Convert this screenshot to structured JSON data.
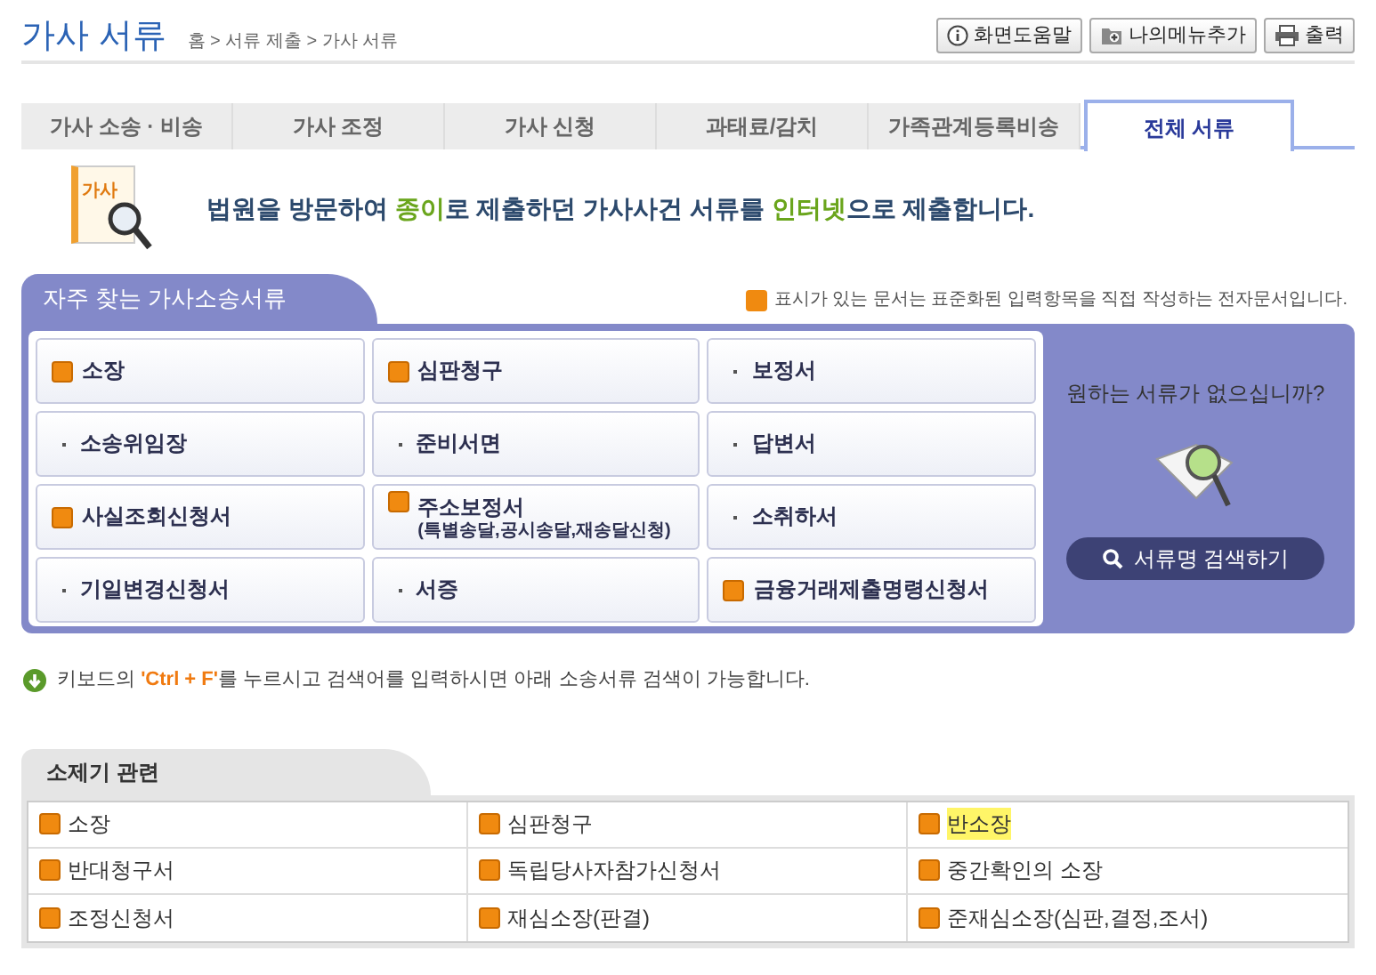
{
  "page_title": "가사 서류",
  "breadcrumb": "홈 > 서류 제출 > 가사 서류",
  "header_buttons": [
    {
      "kind": "help",
      "label": "화면도움말"
    },
    {
      "kind": "add",
      "label": "나의메뉴추가"
    },
    {
      "kind": "print",
      "label": "출력"
    }
  ],
  "tabs": [
    {
      "label": "가사 소송 · 비송",
      "selected": false
    },
    {
      "label": "가사 조정",
      "selected": false
    },
    {
      "label": "가사 신청",
      "selected": false
    },
    {
      "label": "과태료/감치",
      "selected": false
    },
    {
      "label": "가족관계등록비송",
      "selected": false
    },
    {
      "label": "전체 서류",
      "selected": true
    }
  ],
  "banner": {
    "icon_label": "가사",
    "segments": [
      {
        "kind": "plain",
        "text": "법원을 방문하여 "
      },
      {
        "kind": "highlight",
        "text": "종이"
      },
      {
        "kind": "plain",
        "text": "로 제출하던 가사사건 서류를 "
      },
      {
        "kind": "highlight",
        "text": "인터넷"
      },
      {
        "kind": "plain",
        "text": "으로 제출합니다."
      }
    ]
  },
  "frequent": {
    "title": "자주 찾는 가사소송서류",
    "legend": "표시가 있는 문서는 표준화된 입력항목을 직접 작성하는 전자문서입니다.",
    "items": [
      {
        "kind": "e",
        "label": "소장"
      },
      {
        "kind": "e",
        "label": "심판청구"
      },
      {
        "kind": "plain",
        "label": "보정서"
      },
      {
        "kind": "plain",
        "label": "소송위임장"
      },
      {
        "kind": "plain",
        "label": "준비서면"
      },
      {
        "kind": "plain",
        "label": "답변서"
      },
      {
        "kind": "e",
        "label": "사실조회신청서"
      },
      {
        "kind": "e",
        "label": "주소보정서",
        "sublabel": "(특별송달,공시송달,재송달신청)"
      },
      {
        "kind": "plain",
        "label": "소취하서"
      },
      {
        "kind": "plain",
        "label": "기일변경신청서"
      },
      {
        "kind": "plain",
        "label": "서증"
      },
      {
        "kind": "e",
        "label": "금융거래제출명령신청서"
      }
    ],
    "side": {
      "question": "원하는 서류가 없으십니까?",
      "search_button": "서류명 검색하기"
    }
  },
  "hint": [
    {
      "kind": "plain",
      "text": "키보드의 "
    },
    {
      "kind": "highlight",
      "text": "'Ctrl + F'"
    },
    {
      "kind": "plain",
      "text": "를 누르시고 검색어를 입력하시면 아래 소송서류 검색이 가능합니다."
    }
  ],
  "section": {
    "title": "소제기 관련",
    "items": [
      {
        "label": "소장",
        "highlighted": false
      },
      {
        "label": "심판청구",
        "highlighted": false
      },
      {
        "label": "반소장",
        "highlighted": true
      },
      {
        "label": "반대청구서",
        "highlighted": false
      },
      {
        "label": "독립당사자참가신청서",
        "highlighted": false
      },
      {
        "label": "중간확인의 소장",
        "highlighted": false
      },
      {
        "label": "조정신청서",
        "highlighted": false
      },
      {
        "label": "재심소장(판결)",
        "highlighted": false
      },
      {
        "label": "준재심소장(심판,결정,조서)",
        "highlighted": false
      }
    ]
  }
}
